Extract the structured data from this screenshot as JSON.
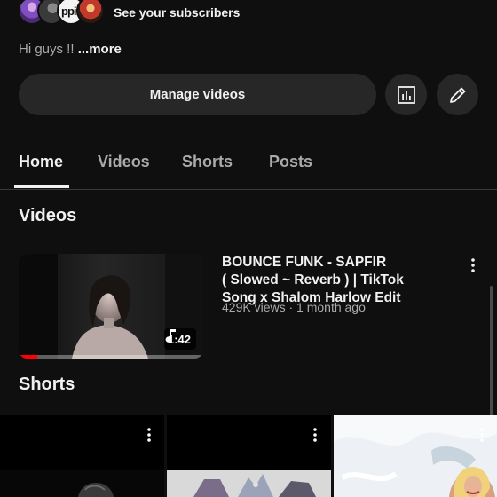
{
  "colors": {
    "background": "#0f0f0f",
    "surface": "#272727",
    "text_primary": "#f1f1f1",
    "text_secondary": "#aaaaaa",
    "progress": "#ff0000"
  },
  "subscribers": {
    "avatars": [
      "subscriber-avatar",
      "subscriber-avatar",
      "subscriber-avatar",
      "subscriber-avatar"
    ],
    "avatar_text": "ppin",
    "link_label": "See your subscribers"
  },
  "description": {
    "text": "Hi guys !! ",
    "more_label": "...more"
  },
  "actions": {
    "manage_label": "Manage videos",
    "analytics_icon": "analytics-icon",
    "edit_icon": "pencil-icon"
  },
  "tabs": [
    {
      "label": "Home",
      "active": true
    },
    {
      "label": "Videos",
      "active": false
    },
    {
      "label": "Shorts",
      "active": false
    },
    {
      "label": "Posts",
      "active": false
    }
  ],
  "videos_section": {
    "title": "Videos",
    "items": [
      {
        "title_lines": [
          "BOUNCE FUNK - SAPFIR",
          "( Slowed ~ Reverb ) | TikTok",
          "Song x Shalom Harlow Edit"
        ],
        "meta": "429K views · 1 month ago",
        "duration": "1:42",
        "duration_icon": "music-note-icon",
        "watch_progress": 0.1
      }
    ]
  },
  "shorts_section": {
    "title": "Shorts",
    "items": [
      {
        "menu_icon": "more-vert-icon"
      },
      {
        "menu_icon": "more-vert-icon"
      },
      {
        "menu_icon": "more-vert-icon"
      }
    ]
  }
}
